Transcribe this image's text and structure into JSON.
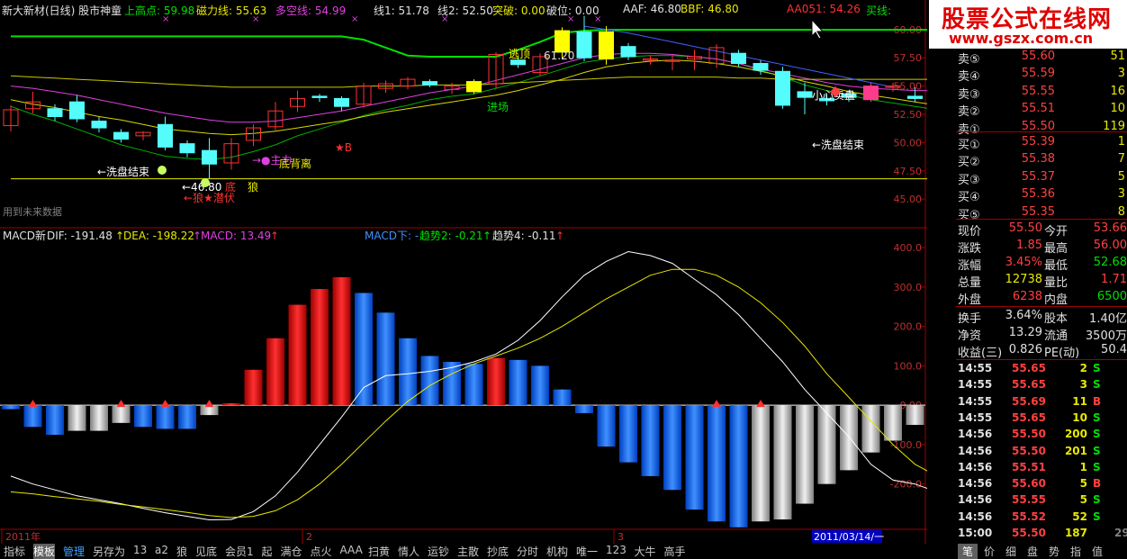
{
  "header": {
    "title": "新大新材(日线) 股市神童",
    "items": [
      {
        "label": "上高点: 59.98",
        "color": "#00e000"
      },
      {
        "label": "磁力线: 55.63",
        "color": "#e8e800"
      },
      {
        "label": "多空线: 54.99",
        "color": "#e040e0"
      },
      {
        "label": "线1: 51.78",
        "color": "#e0e0e0"
      },
      {
        "label": "线2: 52.50",
        "color": "#e0e0e0"
      },
      {
        "label": "突破: 0.00",
        "color": "#e8e800"
      },
      {
        "label": "破位: 0.00",
        "color": "#e0e0e0"
      },
      {
        "label": "AAF: 46.80",
        "color": "#e0e0e0"
      },
      {
        "label": "BBF: 46.80",
        "color": "#e8e800"
      },
      {
        "label": "AA051: 54.26",
        "color": "#ff3030"
      },
      {
        "label": "买线:",
        "color": "#00e000"
      }
    ]
  },
  "watermark": {
    "title": "股票公式在线网",
    "url": "www.gszx.com.cn"
  },
  "price_axis": [
    "60.00",
    "57.50",
    "55.00",
    "52.50",
    "50.00",
    "47.50",
    "45.00"
  ],
  "macd_axis": [
    "400.0",
    "300.0",
    "200.0",
    "100.0",
    "0.00",
    "-100.0",
    "-200.0"
  ],
  "annotations": {
    "escape_top": "逃顶",
    "top_price": "61.20",
    "entry": "进场",
    "careful_sell": "小心卖盘",
    "wash_end_right": "←洗盘结束",
    "wash_end_left": "←洗盘结束",
    "star_b": "★B",
    "main_force": "→●主力",
    "bottom_divergence": "底背离",
    "low_price": "←46.80",
    "wolf_lurk": "←狼★潜伏",
    "di": "底",
    "wolf": "狼",
    "future_data": "用到未来数据"
  },
  "macd_header": {
    "name": "MACD新",
    "dif": "DIF: -191.48",
    "dea": "DEA: -198.22",
    "macd": "MACD: 13.49",
    "macd_down": "MACD下: -",
    "trend2": "趋势2: -0.21",
    "trend4": "趋势4: -0.11"
  },
  "date_axis": {
    "start": "2011年",
    "m2": "2",
    "m3": "3",
    "current": "2011/03/14/一",
    "period": "日线"
  },
  "orderbook": {
    "sells": [
      {
        "label": "卖⑤",
        "price": "55.60",
        "vol": "51"
      },
      {
        "label": "卖④",
        "price": "55.59",
        "vol": "3"
      },
      {
        "label": "卖③",
        "price": "55.55",
        "vol": "16"
      },
      {
        "label": "卖②",
        "price": "55.51",
        "vol": "10"
      },
      {
        "label": "卖①",
        "price": "55.50",
        "vol": "119"
      }
    ],
    "buys": [
      {
        "label": "买①",
        "price": "55.39",
        "vol": "1"
      },
      {
        "label": "买②",
        "price": "55.38",
        "vol": "7"
      },
      {
        "label": "买③",
        "price": "55.37",
        "vol": "5"
      },
      {
        "label": "买④",
        "price": "55.36",
        "vol": "3"
      },
      {
        "label": "买⑤",
        "price": "55.35",
        "vol": "8"
      }
    ]
  },
  "stats": [
    {
      "l1": "现价",
      "v1": "55.50",
      "c1": "#ff4040",
      "l2": "今开",
      "v2": "53.66",
      "c2": "#ff4040"
    },
    {
      "l1": "涨跌",
      "v1": "1.85",
      "c1": "#ff4040",
      "l2": "最高",
      "v2": "56.00",
      "c2": "#ff4040"
    },
    {
      "l1": "涨幅",
      "v1": "3.45%",
      "c1": "#ff4040",
      "l2": "最低",
      "v2": "52.68",
      "c2": "#00e000"
    },
    {
      "l1": "总量",
      "v1": "12738",
      "c1": "#e8e800",
      "l2": "量比",
      "v2": "1.71",
      "c2": "#ff4040"
    },
    {
      "l1": "外盘",
      "v1": "6238",
      "c1": "#ff4040",
      "l2": "内盘",
      "v2": "6500",
      "c2": "#00e000"
    },
    {
      "l1": "换手",
      "v1": "3.64%",
      "c1": "#e0e0e0",
      "l2": "股本",
      "v2": "1.40亿",
      "c2": "#e0e0e0"
    },
    {
      "l1": "净资",
      "v1": "13.29",
      "c1": "#e0e0e0",
      "l2": "流通",
      "v2": "3500万",
      "c2": "#e0e0e0"
    },
    {
      "l1": "收益(三)",
      "v1": "0.826",
      "c1": "#e0e0e0",
      "l2": "PE(动)",
      "v2": "50.4",
      "c2": "#e0e0e0"
    }
  ],
  "ticks": [
    {
      "time": "14:55",
      "price": "55.65",
      "vol": "2",
      "side": "S"
    },
    {
      "time": "14:55",
      "price": "55.65",
      "vol": "3",
      "side": "S"
    },
    {
      "time": "14:55",
      "price": "55.69",
      "vol": "11",
      "side": "B"
    },
    {
      "time": "14:55",
      "price": "55.65",
      "vol": "10",
      "side": "S"
    },
    {
      "time": "14:56",
      "price": "55.50",
      "vol": "200",
      "side": "S"
    },
    {
      "time": "14:56",
      "price": "55.50",
      "vol": "201",
      "side": "S"
    },
    {
      "time": "14:56",
      "price": "55.51",
      "vol": "1",
      "side": "S"
    },
    {
      "time": "14:56",
      "price": "55.60",
      "vol": "5",
      "side": "B"
    },
    {
      "time": "14:56",
      "price": "55.55",
      "vol": "5",
      "side": "S"
    },
    {
      "time": "14:56",
      "price": "55.52",
      "vol": "52",
      "side": "S"
    },
    {
      "time": "15:00",
      "price": "55.50",
      "vol": "187",
      "side": ""
    }
  ],
  "tick_extra": "29",
  "bottom_menu": [
    "指标",
    "模板",
    "管理",
    "另存为",
    "13",
    "a2",
    "狼",
    "见底",
    "会员1",
    "起",
    "满仓",
    "点火",
    "AAA",
    "扫黄",
    "情人",
    "运钞",
    "主散",
    "抄底",
    "分时",
    "机构",
    "唯一",
    "123",
    "大牛",
    "高手"
  ],
  "bottom_menu_active": "模板",
  "bottom_menu_highlight": "管理",
  "right_tabs": [
    "笔",
    "价",
    "细",
    "盘",
    "势",
    "指",
    "值"
  ],
  "chart_data": {
    "type": "candlestick",
    "price_ylim": [
      43.5,
      61.5
    ],
    "candles": [
      {
        "o": 51.5,
        "c": 52.9,
        "h": 53.3,
        "l": 51.0
      },
      {
        "o": 53.0,
        "c": 53.6,
        "h": 54.5,
        "l": 52.6
      },
      {
        "o": 53.0,
        "c": 52.3,
        "h": 53.4,
        "l": 51.9
      },
      {
        "o": 53.6,
        "c": 52.1,
        "h": 54.2,
        "l": 51.8
      },
      {
        "o": 51.9,
        "c": 51.3,
        "h": 52.3,
        "l": 50.9
      },
      {
        "o": 50.9,
        "c": 50.3,
        "h": 51.2,
        "l": 50.0
      },
      {
        "o": 50.6,
        "c": 50.9,
        "h": 51.0,
        "l": 50.2
      },
      {
        "o": 51.6,
        "c": 49.6,
        "h": 52.3,
        "l": 49.3
      },
      {
        "o": 49.9,
        "c": 49.1,
        "h": 50.2,
        "l": 48.7
      },
      {
        "o": 49.3,
        "c": 48.1,
        "h": 50.4,
        "l": 46.8
      },
      {
        "o": 48.2,
        "c": 49.9,
        "h": 50.4,
        "l": 47.6
      },
      {
        "o": 50.2,
        "c": 51.3,
        "h": 51.6,
        "l": 49.7
      },
      {
        "o": 51.4,
        "c": 52.8,
        "h": 53.6,
        "l": 51.1
      },
      {
        "o": 53.2,
        "c": 53.9,
        "h": 54.6,
        "l": 52.7
      },
      {
        "o": 54.1,
        "c": 54.0,
        "h": 54.3,
        "l": 53.6
      },
      {
        "o": 53.9,
        "c": 53.2,
        "h": 54.1,
        "l": 52.8
      },
      {
        "o": 53.4,
        "c": 55.0,
        "h": 55.3,
        "l": 53.1
      },
      {
        "o": 54.8,
        "c": 55.2,
        "h": 55.5,
        "l": 54.4
      },
      {
        "o": 55.0,
        "c": 55.6,
        "h": 55.8,
        "l": 54.7
      },
      {
        "o": 55.4,
        "c": 55.1,
        "h": 55.6,
        "l": 54.9
      },
      {
        "o": 54.7,
        "c": 55.0,
        "h": 55.3,
        "l": 54.3
      },
      {
        "o": 54.5,
        "c": 55.4,
        "h": 55.6,
        "l": 54.3
      },
      {
        "o": 55.2,
        "c": 57.8,
        "h": 58.0,
        "l": 54.8
      },
      {
        "o": 57.3,
        "c": 56.9,
        "h": 57.6,
        "l": 56.6
      },
      {
        "o": 56.2,
        "c": 57.6,
        "h": 57.9,
        "l": 55.9
      },
      {
        "o": 58.0,
        "c": 59.9,
        "h": 60.2,
        "l": 57.4
      },
      {
        "o": 59.8,
        "c": 57.5,
        "h": 61.2,
        "l": 57.2
      },
      {
        "o": 57.4,
        "c": 59.8,
        "h": 60.3,
        "l": 56.9
      },
      {
        "o": 58.5,
        "c": 57.6,
        "h": 58.8,
        "l": 57.3
      },
      {
        "o": 57.3,
        "c": 57.4,
        "h": 57.7,
        "l": 56.9
      },
      {
        "o": 57.2,
        "c": 57.3,
        "h": 57.7,
        "l": 56.4
      },
      {
        "o": 57.4,
        "c": 57.6,
        "h": 58.2,
        "l": 56.4
      },
      {
        "o": 57.0,
        "c": 58.4,
        "h": 58.7,
        "l": 56.6
      },
      {
        "o": 57.9,
        "c": 57.0,
        "h": 58.2,
        "l": 56.7
      },
      {
        "o": 57.0,
        "c": 56.4,
        "h": 57.3,
        "l": 56.0
      },
      {
        "o": 56.3,
        "c": 53.3,
        "h": 56.7,
        "l": 53.0
      },
      {
        "o": 54.5,
        "c": 54.0,
        "h": 55.3,
        "l": 52.5
      },
      {
        "o": 53.9,
        "c": 53.7,
        "h": 54.3,
        "l": 53.3
      },
      {
        "o": 54.3,
        "c": 54.0,
        "h": 54.5,
        "l": 53.6
      },
      {
        "o": 55.0,
        "c": 53.8,
        "h": 55.3,
        "l": 53.6
      },
      {
        "o": 54.9,
        "c": 55.0,
        "h": 55.3,
        "l": 54.5
      },
      {
        "o": 54.1,
        "c": 53.9,
        "h": 54.9,
        "l": 53.6
      },
      {
        "o": 54.0,
        "c": 53.9,
        "h": 54.2,
        "l": 53.6
      },
      {
        "o": 53.9,
        "c": 53.4,
        "h": 54.2,
        "l": 53.3
      },
      {
        "o": 53.9,
        "c": 53.6,
        "h": 54.3,
        "l": 53.3
      },
      {
        "o": 53.7,
        "c": 55.5,
        "h": 56.0,
        "l": 52.7
      }
    ],
    "lines": [
      {
        "name": "upper",
        "color": "#00e000",
        "values": [
          59.4,
          59.4,
          59.4,
          59.4,
          59.4,
          59.4,
          59.4,
          59.4,
          59.4,
          59.4,
          59.4,
          59.4,
          59.4,
          59.4,
          59.4,
          59.4,
          59.1,
          58.4,
          57.7,
          57.6,
          57.6,
          57.6,
          57.6,
          58.2,
          58.9,
          59.7,
          59.9,
          59.98,
          59.98,
          59.98,
          59.98,
          59.98,
          59.98,
          59.98,
          59.98,
          59.98,
          59.98,
          59.98,
          59.98,
          59.98,
          59.98,
          59.98,
          59.98,
          59.98,
          59.98,
          59.98
        ]
      },
      {
        "name": "ma_green",
        "color": "#00b000",
        "values": [
          53.2,
          52.5,
          51.9,
          51.2,
          50.5,
          49.8,
          49.3,
          48.8,
          48.6,
          48.5,
          48.7,
          49.2,
          49.8,
          50.6,
          51.2,
          51.8,
          52.4,
          52.9,
          53.3,
          53.8,
          54.1,
          54.3,
          54.8,
          55.3,
          55.9,
          56.5,
          57.1,
          57.4,
          57.6,
          57.7,
          57.7,
          57.6,
          57.4,
          57.0,
          56.4,
          55.8,
          55.1,
          54.6,
          54.2,
          53.8,
          53.5,
          53.2,
          52.9,
          52.6,
          52.3,
          51.78
        ]
      },
      {
        "name": "ma_yellow",
        "color": "#d8d800",
        "values": [
          53.8,
          53.4,
          53.1,
          52.7,
          52.3,
          52.0,
          51.6,
          51.2,
          51.0,
          50.8,
          50.7,
          50.8,
          51.0,
          51.3,
          51.6,
          51.9,
          52.3,
          52.7,
          53.0,
          53.3,
          53.6,
          53.9,
          54.2,
          54.6,
          55.1,
          55.6,
          56.2,
          56.7,
          57.0,
          57.2,
          57.3,
          57.2,
          57.0,
          56.7,
          56.3,
          55.9,
          55.4,
          55.0,
          54.5,
          54.2,
          53.9,
          53.6,
          53.3,
          53.0,
          52.7,
          52.5
        ]
      },
      {
        "name": "duokong",
        "color": "#e040e0",
        "values": [
          55.0,
          54.8,
          54.5,
          54.2,
          53.8,
          53.4,
          53.0,
          52.6,
          52.3,
          52.0,
          51.8,
          51.8,
          51.9,
          52.2,
          52.5,
          52.8,
          53.2,
          53.6,
          54.0,
          54.4,
          54.7,
          55.0,
          55.5,
          56.0,
          56.5,
          57.0,
          57.5,
          57.8,
          57.9,
          57.9,
          57.8,
          57.6,
          57.4,
          57.0,
          56.5,
          56.1,
          55.7,
          55.3,
          55.0,
          54.8,
          54.7,
          54.6,
          54.6,
          54.7,
          54.8,
          54.99
        ]
      },
      {
        "name": "cili",
        "color": "#c8c800",
        "values": [
          55.9,
          55.8,
          55.7,
          55.6,
          55.5,
          55.4,
          55.3,
          55.2,
          55.1,
          55.0,
          54.9,
          54.9,
          54.9,
          54.9,
          54.9,
          54.9,
          55.0,
          55.0,
          55.0,
          55.1,
          55.1,
          55.1,
          55.2,
          55.3,
          55.4,
          55.5,
          55.6,
          55.7,
          55.8,
          55.8,
          55.8,
          55.8,
          55.8,
          55.7,
          55.7,
          55.6,
          55.6,
          55.6,
          55.6,
          55.6,
          55.6,
          55.6,
          55.6,
          55.6,
          55.6,
          55.63
        ]
      },
      {
        "name": "blue_trend",
        "color": "#4060ff",
        "values": [
          null,
          null,
          null,
          null,
          null,
          null,
          null,
          null,
          null,
          null,
          null,
          null,
          null,
          null,
          null,
          null,
          null,
          null,
          null,
          null,
          null,
          null,
          null,
          null,
          null,
          null,
          60.3,
          60.0,
          59.7,
          59.3,
          58.9,
          58.5,
          58.1,
          57.7,
          57.3,
          56.9,
          56.5,
          56.1,
          55.7,
          55.3,
          54.9,
          null,
          null,
          null,
          null,
          null
        ]
      },
      {
        "name": "aaf",
        "color": "#e8e800",
        "values": [
          46.8,
          46.8,
          46.8,
          46.8,
          46.8,
          46.8,
          46.8,
          46.8,
          46.8,
          46.8,
          46.8,
          46.8,
          46.8,
          46.8,
          46.8,
          46.8,
          46.8,
          46.8,
          46.8,
          46.8,
          46.8,
          46.8,
          46.8,
          46.8,
          46.8,
          46.8,
          46.8,
          46.8,
          46.8,
          46.8,
          46.8,
          46.8,
          46.8,
          46.8,
          46.8,
          46.8,
          46.8,
          46.8,
          46.8,
          46.8,
          46.8,
          46.8,
          46.8,
          46.8,
          46.8,
          46.8
        ]
      }
    ],
    "macd_ylim": [
      -315,
      430
    ],
    "macd_bars": [
      -10,
      -55,
      -75,
      -65,
      -65,
      -45,
      -55,
      -60,
      -60,
      -25,
      5,
      90,
      170,
      255,
      295,
      325,
      285,
      235,
      170,
      125,
      110,
      105,
      120,
      115,
      100,
      40,
      -20,
      -105,
      -145,
      -180,
      -215,
      -265,
      -295,
      -310,
      -295,
      -290,
      -250,
      -200,
      -165,
      -120,
      -90,
      -50,
      -25,
      -5,
      -5,
      13.49
    ],
    "macd_colors": [
      "b",
      "b",
      "b",
      "w",
      "w",
      "w",
      "b",
      "b",
      "b",
      "w",
      "r",
      "r",
      "r",
      "r",
      "r",
      "r",
      "b",
      "b",
      "b",
      "b",
      "b",
      "b",
      "r",
      "b",
      "b",
      "b",
      "b",
      "b",
      "b",
      "b",
      "b",
      "b",
      "b",
      "b",
      "w",
      "w",
      "w",
      "w",
      "w",
      "w",
      "w",
      "w",
      "w",
      "w",
      "w",
      "r"
    ],
    "dif": [
      -180,
      -200,
      -215,
      -230,
      -240,
      -250,
      -262,
      -273,
      -282,
      -291,
      -290,
      -270,
      -230,
      -170,
      -100,
      -30,
      45,
      75,
      80,
      86,
      96,
      110,
      130,
      165,
      215,
      275,
      330,
      365,
      390,
      380,
      360,
      320,
      280,
      230,
      170,
      110,
      40,
      -20,
      -80,
      -150,
      -190,
      -200,
      -220,
      -210,
      -200,
      -191.48
    ],
    "dea": [
      -220,
      -225,
      -232,
      -238,
      -244,
      -252,
      -258,
      -265,
      -272,
      -280,
      -285,
      -282,
      -268,
      -240,
      -200,
      -150,
      -95,
      -40,
      10,
      50,
      80,
      105,
      125,
      145,
      170,
      200,
      235,
      270,
      300,
      330,
      345,
      345,
      330,
      300,
      260,
      210,
      150,
      80,
      20,
      -40,
      -100,
      -150,
      -180,
      -195,
      -200,
      -198.22
    ]
  }
}
